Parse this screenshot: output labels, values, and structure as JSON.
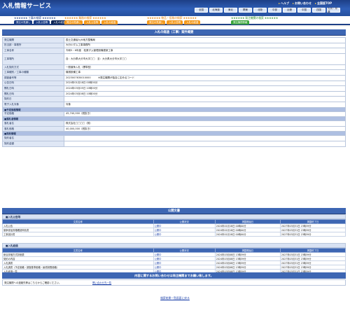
{
  "app_title": "入札情報サービス",
  "top_links": [
    "ヘルプ",
    "お問い合わせ",
    "全国版TOP"
  ],
  "regions": [
    "全国",
    "北海道",
    "東北",
    "関東",
    "北陸",
    "中部",
    "近畿",
    "中国",
    "四国",
    "九州・沖縄"
  ],
  "categories": [
    {
      "title": "工事の検索",
      "tabs": [
        "発注の見通し",
        "入札公告等",
        "入札の経過"
      ],
      "active": 2
    },
    {
      "title": "業務の検索",
      "tabs": [
        "発注の見通し",
        "入札公告等",
        "入札の経過"
      ],
      "active": -1
    },
    {
      "title": "物品・役務の検索",
      "tabs": [
        "発注の見通し",
        "入札公告等",
        "入札の経過"
      ],
      "active": -1
    },
    {
      "title": "発注機関の検索",
      "tabs": [
        "発注機関情報"
      ],
      "active": -1
    }
  ],
  "page_heading": "入札の経過（工事）案件概要",
  "detail": {
    "rows": [
      {
        "label": "発注機関",
        "value": "国土交通省九州地方整備局"
      },
      {
        "label": "担当部・事務所",
        "value": "大分川ダム工事事務所"
      },
      {
        "label": "工事名称",
        "value": "令和5・6年度　松原ダム管理設備更新工事"
      },
      {
        "label": "工事場所",
        "value": "自：大分県大分市大字□□　至：大分県大分市大字□□",
        "tall": true
      },
      {
        "label": "入札契約方式",
        "value": "一般競争入札（標準型）"
      },
      {
        "label": "工事種別／工事の種類",
        "value": "機械設備工事"
      },
      {
        "label": "調査番号等",
        "value": "2023007630010000　　　※発注機関が独自に定めるコード"
      },
      {
        "label": "公告日時",
        "value": "2024年01月18日 00時00分"
      },
      {
        "label": "開札日時",
        "value": "2024年03月05日 10時00分"
      },
      {
        "label": "開札日時",
        "value": "2024年03月08日 10時00分"
      },
      {
        "label": "契約日",
        "value": ""
      },
      {
        "label": "電子入札対象",
        "value": "対象"
      }
    ],
    "price_section": "予定価格情報",
    "price_rows": [
      {
        "label": "予定価格",
        "value": "45,740,000（税抜き）"
      }
    ],
    "winner_section": "落札者情報",
    "winner_rows": [
      {
        "label": "落札者名",
        "value": "株式会社□□□□（株）"
      },
      {
        "label": "落札価格",
        "value": "40,000,000（税抜き）"
      }
    ],
    "contract_section": "契約情報",
    "contract_rows": [
      {
        "label": "契約者名",
        "value": ""
      },
      {
        "label": "契約金額",
        "value": ""
      }
    ]
  },
  "docs_heading": "公開文書",
  "doc_sections": [
    {
      "title": "入札公告等",
      "headers": [
        "文書名称",
        "公開状況",
        "掲載開始日",
        "掲載終了日"
      ],
      "rows": [
        [
          "入札公告",
          "公開中",
          "2024年01月18日 00時00分",
          "2027年03月31日 23時59分"
        ],
        [
          "競争参加資格確認申請書",
          "公開中",
          "2024年01月18日 00時00分",
          "2027年03月31日 23時59分"
        ],
        [
          "工事設計書",
          "公開中",
          "2024年01月18日 00時00分",
          "2027年03月31日 23時59分"
        ]
      ]
    },
    {
      "title": "入札経過",
      "headers": [
        "文書名称",
        "公開状況",
        "掲載開始日",
        "掲載終了日"
      ],
      "rows": [
        [
          "総合評価方式評価表",
          "公開中",
          "2024年03月08日 13時59分",
          "2027年03月31日 23時59分"
        ],
        [
          "契約の内容",
          "公開中",
          "2024年03月08日 13時59分",
          "2027年03月31日 23時59分"
        ],
        [
          "入札調書",
          "公開中",
          "2024年03月08日 13時59分",
          "2027年03月31日 23時59分"
        ],
        [
          "入札調書（予定価格・調査基準価格・最低制限価格）",
          "公開中",
          "2024年03月08日 13時59分",
          "2027年03月31日 23時59分"
        ],
        [
          "入札経過一覧",
          "公開中",
          "2024年03月08日 13時59分",
          "2027年03月31日 23時59分"
        ]
      ]
    }
  ],
  "contact_heading": "内容に関するお問い合わせは発注機関までお願い致します。",
  "contact_label": "発注機関への連絡先等はこちらからご確認ください。",
  "contact_link": "問い合わせ先一覧",
  "back_link": "検索結果一覧画面に戻る",
  "colors": {
    "brand": "#2f5fb7",
    "tab_blue": "#1d3f86",
    "tab_orange": "#f39a1e",
    "tab_green": "#3aa53a",
    "tab_active": "#0e2656"
  }
}
